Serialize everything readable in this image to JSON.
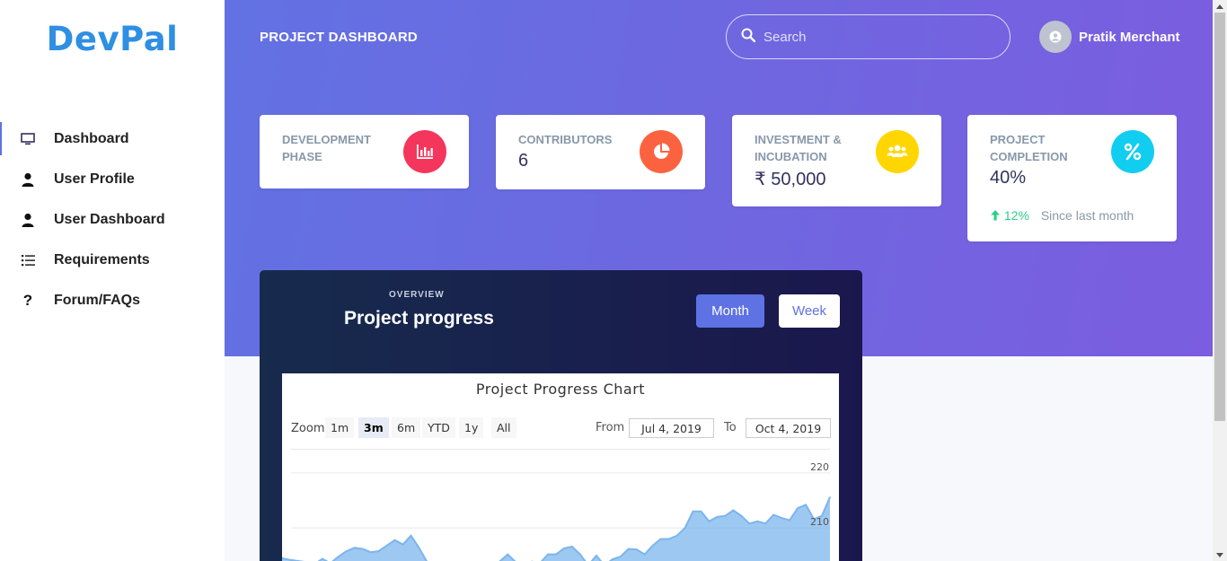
{
  "brand": "DevPal",
  "nav": [
    {
      "label": "Dashboard",
      "icon": "monitor-icon",
      "active": true
    },
    {
      "label": "User Profile",
      "icon": "user-icon"
    },
    {
      "label": "User Dashboard",
      "icon": "user-icon"
    },
    {
      "label": "Requirements",
      "icon": "list-icon"
    },
    {
      "label": "Forum/FAQs",
      "icon": "question-icon"
    }
  ],
  "header": {
    "title": "PROJECT DASHBOARD",
    "search_placeholder": "Search",
    "user_name": "Pratik Merchant"
  },
  "cards": [
    {
      "label": "DEVELOPMENT PHASE",
      "value": "",
      "icon": "bar-chart-icon",
      "color": "#f5365c"
    },
    {
      "label": "CONTRIBUTORS",
      "value": "6",
      "icon": "pie-chart-icon",
      "color": "#fb6340"
    },
    {
      "label": "INVESTMENT & INCUBATION",
      "value": "₹ 50,000",
      "icon": "users-icon",
      "color": "#ffd600"
    },
    {
      "label": "PROJECT COMPLETION",
      "value": "40%",
      "icon": "percent-icon",
      "color": "#11cdef",
      "change": "12%",
      "change_note": "Since last month"
    }
  ],
  "overview": {
    "kicker": "OVERVIEW",
    "title": "Project progress",
    "buttons": {
      "month": "Month",
      "week": "Week"
    }
  },
  "chart": {
    "title": "Project Progress Chart",
    "zoom_label": "Zoom",
    "zoom_options": [
      "1m",
      "3m",
      "6m",
      "YTD",
      "1y",
      "All"
    ],
    "zoom_selected": "3m",
    "from_label": "From",
    "from_value": "Jul 4, 2019",
    "to_label": "To",
    "to_value": "Oct 4, 2019"
  },
  "chart_data": {
    "type": "area",
    "title": "Project Progress Chart",
    "y_tick_labels": [
      "220",
      "210"
    ],
    "ylim": [
      204,
      226
    ],
    "x_range": [
      "Jul 4, 2019",
      "Oct 4, 2019"
    ],
    "values": [
      204.5,
      204.2,
      204.0,
      203.8,
      203.4,
      204.4,
      203.6,
      204.8,
      205.8,
      206.4,
      206.2,
      205.6,
      205.8,
      206.8,
      207.8,
      207.0,
      208.6,
      206.4,
      203.8,
      203.6,
      203.4,
      203.3,
      203.6,
      203.2,
      203.0,
      203.6,
      203.3,
      203.9,
      205.2,
      203.8,
      203.4,
      203.9,
      203.6,
      205.2,
      205.2,
      206.3,
      206.6,
      205.2,
      203.2,
      205.0,
      203.2,
      204.3,
      204.8,
      206.2,
      206.1,
      205.2,
      206.8,
      208.0,
      208.0,
      208.6,
      210.0,
      213.0,
      213.0,
      211.2,
      212.0,
      212.2,
      213.2,
      212.2,
      210.8,
      211.2,
      210.8,
      212.4,
      211.8,
      211.4,
      213.6,
      214.2,
      211.6,
      212.2,
      215.6
    ],
    "color": "#7cb5ec",
    "grid": true
  }
}
